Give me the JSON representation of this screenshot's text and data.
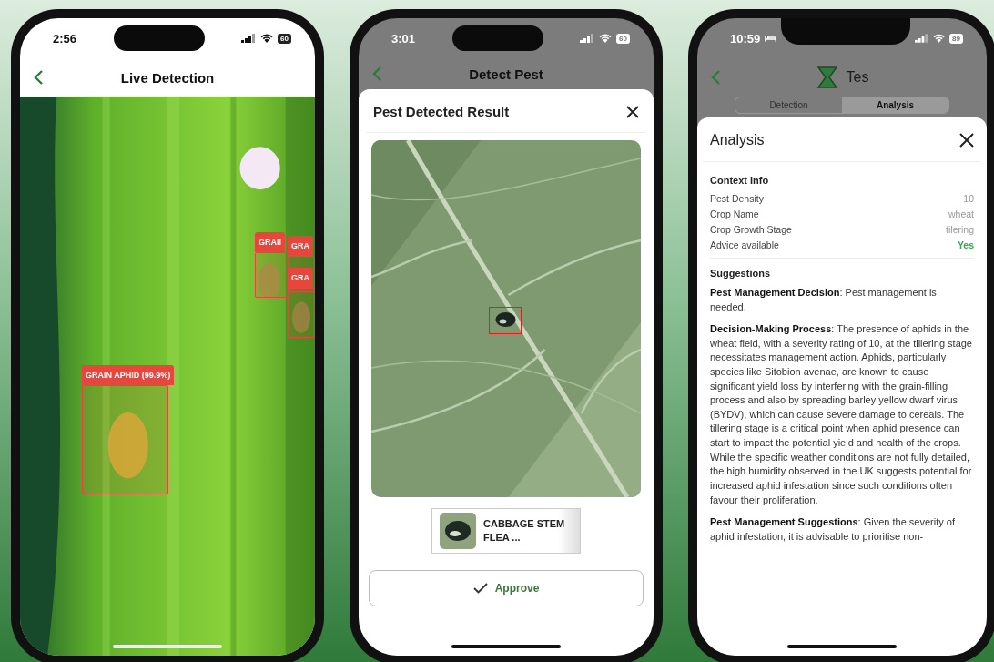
{
  "phones": [
    {
      "kind": "live",
      "status": {
        "time": "2:56",
        "battery": "60"
      },
      "header": {
        "title": "Live Detection"
      },
      "detections": [
        {
          "label": "GRAIN APHID (99.9%)"
        },
        {
          "label": "GRAII"
        },
        {
          "label": "GRA"
        },
        {
          "label": "GRA"
        }
      ]
    },
    {
      "kind": "result",
      "status": {
        "time": "3:01",
        "battery": "60"
      },
      "header": {
        "title": "Detect Pest"
      },
      "sheet": {
        "title": "Pest Detected Result",
        "chip": "CABBAGE STEM FLEA ...",
        "button": "Approve"
      }
    },
    {
      "kind": "analysis",
      "status": {
        "time": "10:59",
        "battery": "89"
      },
      "header": {
        "title": "Tes"
      },
      "tabs": [
        {
          "label": "Detection",
          "selected": false
        },
        {
          "label": "Analysis",
          "selected": true
        }
      ],
      "sheet": {
        "title": "Analysis",
        "context": {
          "heading": "Context Info",
          "rows": [
            {
              "label": "Pest Density",
              "value": "10",
              "highlight": false
            },
            {
              "label": "Crop Name",
              "value": "wheat",
              "highlight": false
            },
            {
              "label": "Crop Growth Stage",
              "value": "tilering",
              "highlight": false
            },
            {
              "label": "Advice available",
              "value": "Yes",
              "highlight": true
            }
          ]
        },
        "suggestions": {
          "heading": "Suggestions",
          "paragraphs": [
            "**Pest Management Decision**: Pest management is needed.",
            "**Decision-Making Process**: The presence of aphids in the wheat field, with a severity rating of 10, at the tillering stage necessitates management action. Aphids, particularly species like Sitobion avenae, are known to cause significant yield loss by interfering with the grain-filling process and also by spreading barley yellow dwarf virus (BYDV), which can cause severe damage to cereals. The tillering stage is a critical point when aphid presence can start to impact the potential yield and health of the crops. While the specific weather conditions are not fully detailed, the high humidity observed in the UK suggests potential for increased aphid infestation since such conditions often favour their proliferation.",
            "**Pest Management Suggestions**: Given the severity of aphid infestation, it is advisable to prioritise non-"
          ]
        }
      }
    }
  ]
}
